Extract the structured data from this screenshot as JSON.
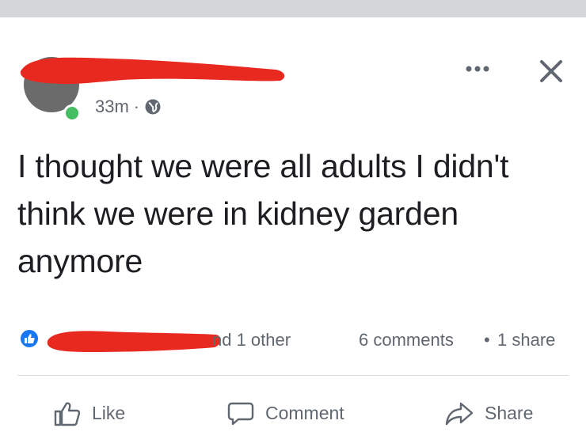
{
  "post": {
    "author_name": "",
    "timestamp": "33m",
    "timestamp_separator": "·",
    "privacy_icon": "globe-icon",
    "more_icon": "more-dots-icon",
    "close_icon": "close-icon",
    "text": "I thought we were all adults I didn't think we were in  kidney garden anymore"
  },
  "reactions": {
    "reaction_icon": "like-reaction-icon",
    "reactor_names_visible": "nd 1 other",
    "comments": "6 comments",
    "separator": "•",
    "shares": "1 share"
  },
  "actions": {
    "like_label": "Like",
    "comment_label": "Comment",
    "share_label": "Share"
  },
  "colors": {
    "redaction": "#e8291f",
    "facebook_blue": "#1877f2",
    "online_green": "#45bd62",
    "secondary_text": "#606770"
  }
}
